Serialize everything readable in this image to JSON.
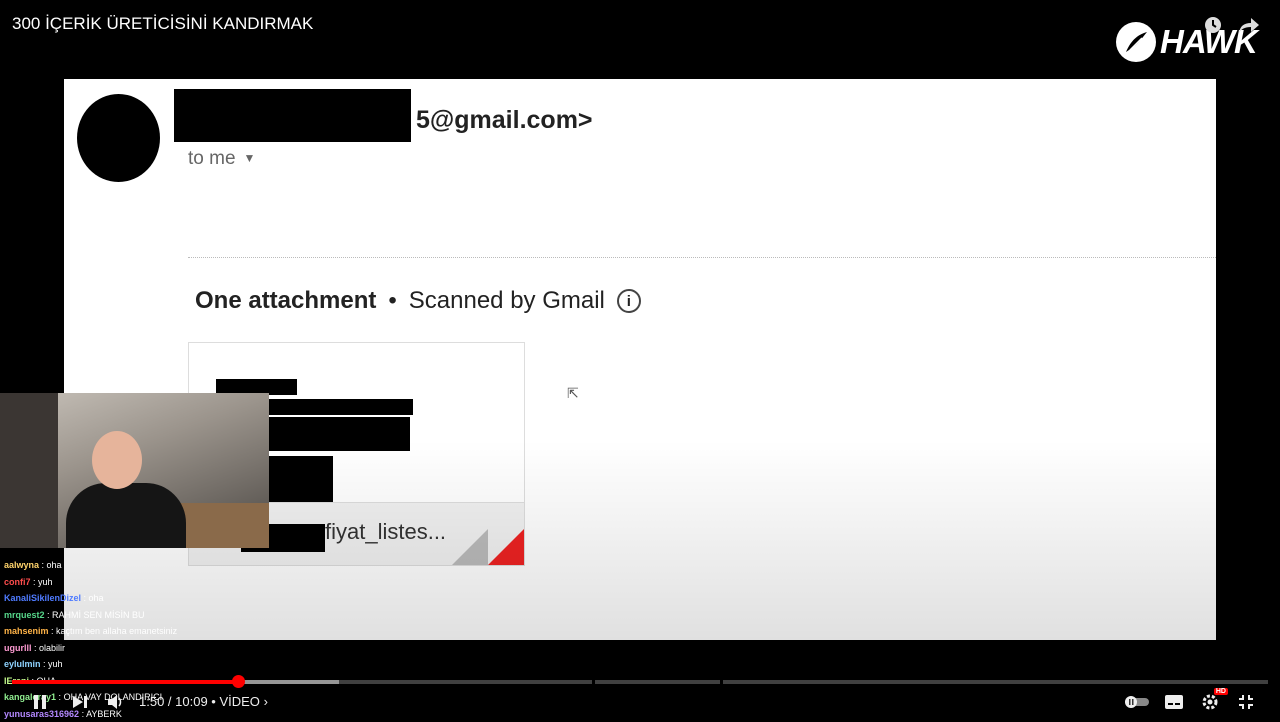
{
  "window": {
    "title": "300 İÇERİK ÜRETİCİSİNİ KANDIRMAK"
  },
  "branding": {
    "logo_text": "HAWK"
  },
  "email": {
    "sender_suffix": "5@gmail.com>",
    "to": "to me",
    "attachment_label": "One attachment",
    "scanned": "Scanned by Gmail",
    "file_name": "fiyat_listes..."
  },
  "chat": [
    {
      "user": "aalwyna",
      "text": "oha",
      "color": "#ffd36b"
    },
    {
      "user": "confi7",
      "text": "yuh",
      "color": "#ff4d4d"
    },
    {
      "user": "KanaliSikilenDizel",
      "text": "oha",
      "color": "#4f7bff"
    },
    {
      "user": "mrquest2",
      "text": "RAHMİ SEN MİSİN BU",
      "color": "#56d68a"
    },
    {
      "user": "mahsenim",
      "text": "kaçtım ben allaha emanetsiniz",
      "color": "#ffb347"
    },
    {
      "user": "ugurlll",
      "text": "olabilir",
      "color": "#ff9bd3"
    },
    {
      "user": "eylulmin",
      "text": "yuh",
      "color": "#8fd3ff"
    },
    {
      "user": "lEreni",
      "text": "OHA",
      "color": "#c8ff8f"
    },
    {
      "user": "kangaleray1",
      "text": "OHA VAY DOLANDIRICI",
      "color": "#90ee90"
    },
    {
      "user": "yunusaras316962",
      "text": "AYBERK",
      "color": "#b388ff"
    }
  ],
  "player": {
    "time": "1:50 / 10:09",
    "chapter": "VİDEO",
    "progress_played": 0.18,
    "progress_buffered": 0.26
  },
  "icons": {
    "clock": "clock-icon",
    "share": "share-icon",
    "pause": "pause-icon",
    "next": "next-icon",
    "volume": "volume-icon",
    "autoplay": "autoplay-toggle-icon",
    "captions": "captions-icon",
    "settings": "settings-icon",
    "fullscreen": "exit-fullscreen-icon"
  },
  "colors": {
    "accent": "#ff0000"
  }
}
